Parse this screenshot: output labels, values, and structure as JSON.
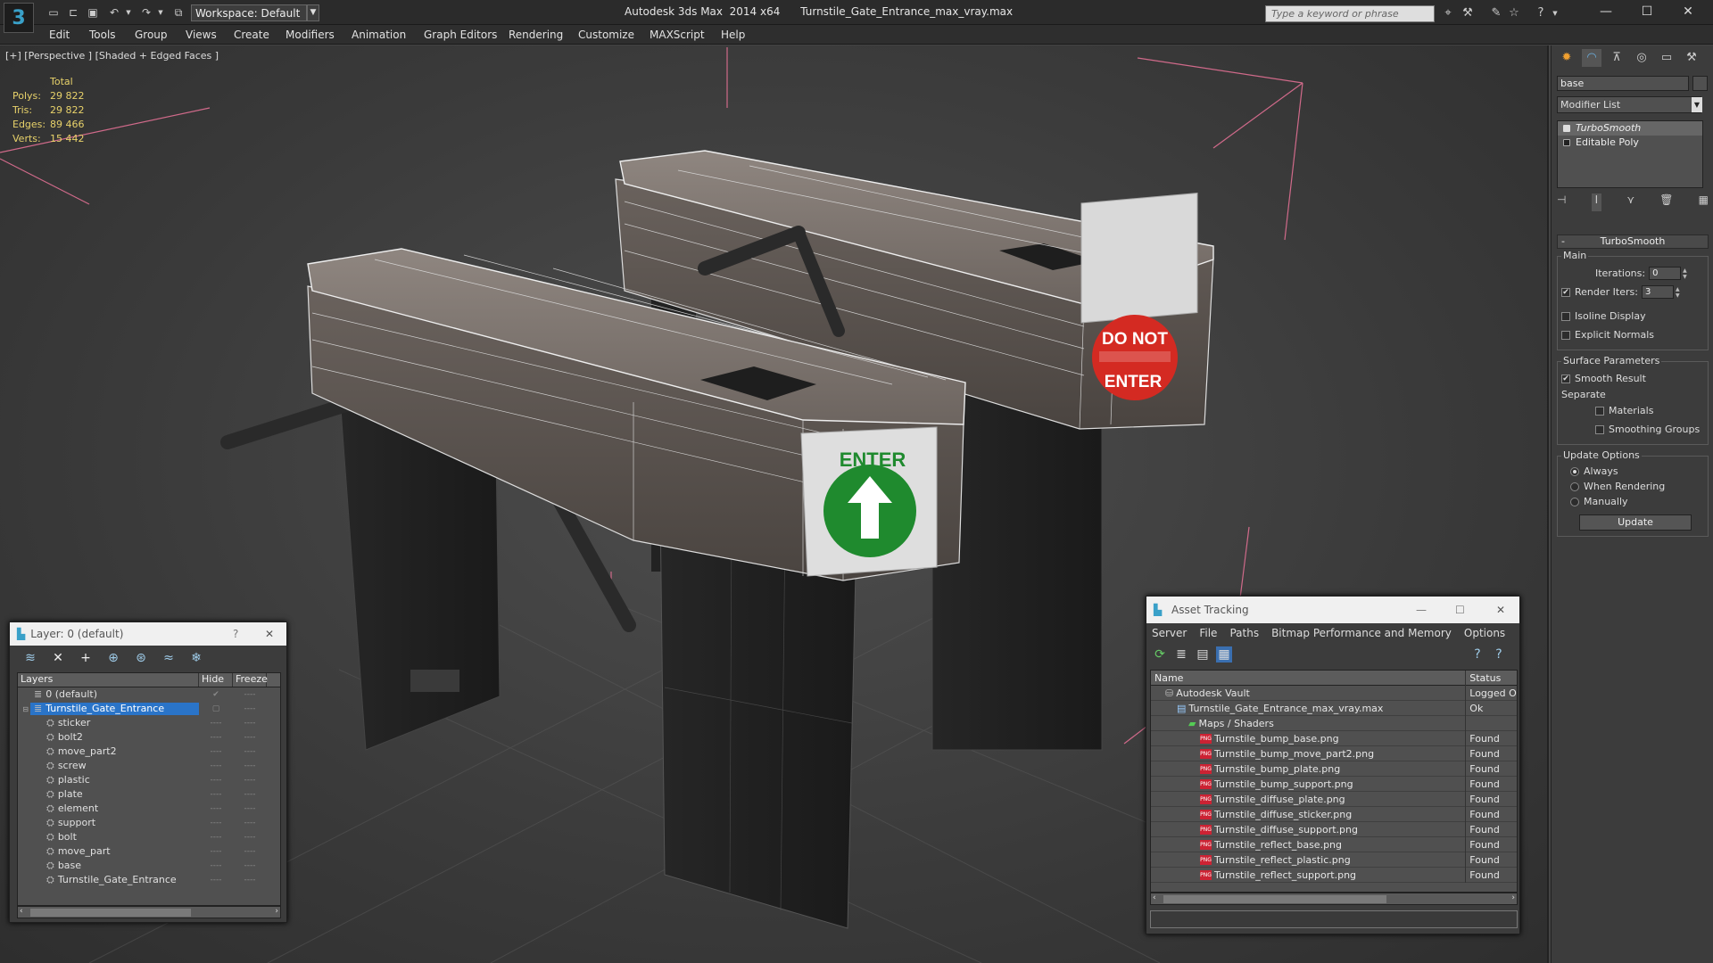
{
  "window": {
    "title": "Autodesk 3ds Max  2014 x64      Turnstile_Gate_Entrance_max_vray.max",
    "workspace": "Workspace: Default",
    "search_placeholder": "Type a keyword or phrase"
  },
  "menu": [
    "Edit",
    "Tools",
    "Group",
    "Views",
    "Create",
    "Modifiers",
    "Animation",
    "Graph Editors",
    "Rendering",
    "Customize",
    "MAXScript",
    "Help"
  ],
  "viewport": {
    "label": "[+] [Perspective ] [Shaded + Edged Faces ]",
    "stats": {
      "header": "Total",
      "rows": [
        {
          "label": "Polys:",
          "value": "29 822"
        },
        {
          "label": "Tris:",
          "value": "29 822"
        },
        {
          "label": "Edges:",
          "value": "89 466"
        },
        {
          "label": "Verts:",
          "value": "15 442"
        }
      ]
    },
    "sign_enter": "ENTER",
    "sign_do_not_line1": "DO NOT",
    "sign_do_not_line2": "ENTER"
  },
  "layer_panel": {
    "title": "Layer: 0 (default)",
    "help": "?",
    "close": "✕",
    "columns": {
      "layers": "Layers",
      "hide": "Hide",
      "freeze": "Freeze"
    },
    "rows": [
      {
        "name": "0 (default)",
        "hide": "✔",
        "freeze": "----",
        "selected": false
      },
      {
        "name": "Turnstile_Gate_Entrance",
        "hide": "▢",
        "freeze": "----",
        "selected": true
      },
      {
        "name": "sticker",
        "hide": "----",
        "freeze": "----"
      },
      {
        "name": "bolt2",
        "hide": "----",
        "freeze": "----"
      },
      {
        "name": "move_part2",
        "hide": "----",
        "freeze": "----"
      },
      {
        "name": "screw",
        "hide": "----",
        "freeze": "----"
      },
      {
        "name": "plastic",
        "hide": "----",
        "freeze": "----"
      },
      {
        "name": "plate",
        "hide": "----",
        "freeze": "----"
      },
      {
        "name": "element",
        "hide": "----",
        "freeze": "----"
      },
      {
        "name": "support",
        "hide": "----",
        "freeze": "----"
      },
      {
        "name": "bolt",
        "hide": "----",
        "freeze": "----"
      },
      {
        "name": "move_part",
        "hide": "----",
        "freeze": "----"
      },
      {
        "name": "base",
        "hide": "----",
        "freeze": "----"
      },
      {
        "name": "Turnstile_Gate_Entrance",
        "hide": "----",
        "freeze": "----"
      }
    ]
  },
  "asset_panel": {
    "title": "Asset Tracking",
    "menu": [
      "Server",
      "File",
      "Paths",
      "Bitmap Performance and Memory",
      "Options"
    ],
    "columns": {
      "name": "Name",
      "status": "Status"
    },
    "rows": [
      {
        "name": "Autodesk Vault",
        "status": "Logged O",
        "indent": 0
      },
      {
        "name": "Turnstile_Gate_Entrance_max_vray.max",
        "status": "Ok",
        "indent": 1
      },
      {
        "name": "Maps / Shaders",
        "status": "",
        "indent": 2
      },
      {
        "name": "Turnstile_bump_base.png",
        "status": "Found",
        "indent": 3
      },
      {
        "name": "Turnstile_bump_move_part2.png",
        "status": "Found",
        "indent": 3
      },
      {
        "name": "Turnstile_bump_plate.png",
        "status": "Found",
        "indent": 3
      },
      {
        "name": "Turnstile_bump_support.png",
        "status": "Found",
        "indent": 3
      },
      {
        "name": "Turnstile_diffuse_plate.png",
        "status": "Found",
        "indent": 3
      },
      {
        "name": "Turnstile_diffuse_sticker.png",
        "status": "Found",
        "indent": 3
      },
      {
        "name": "Turnstile_diffuse_support.png",
        "status": "Found",
        "indent": 3
      },
      {
        "name": "Turnstile_reflect_base.png",
        "status": "Found",
        "indent": 3
      },
      {
        "name": "Turnstile_reflect_plastic.png",
        "status": "Found",
        "indent": 3
      },
      {
        "name": "Turnstile_reflect_support.png",
        "status": "Found",
        "indent": 3
      }
    ]
  },
  "command_panel": {
    "object_name": "base",
    "modifier_list": "Modifier List",
    "stack": [
      {
        "name": "TurboSmooth",
        "active": true
      },
      {
        "name": "Editable Poly",
        "active": false
      }
    ],
    "rollout_title": "TurboSmooth",
    "main_group": "Main",
    "iterations_label": "Iterations:",
    "iterations_value": "0",
    "render_iters_label": "Render Iters:",
    "render_iters_value": "3",
    "isoline_label": "Isoline Display",
    "explicit_normals_label": "Explicit Normals",
    "surface_group": "Surface Parameters",
    "smooth_result_label": "Smooth Result",
    "separate_label": "Separate",
    "materials_label": "Materials",
    "smoothing_groups_label": "Smoothing Groups",
    "update_group": "Update Options",
    "always_label": "Always",
    "when_rendering_label": "When Rendering",
    "manually_label": "Manually",
    "update_button": "Update"
  },
  "colors": {
    "selection": "#2a74c8",
    "stats_text": "#e8d26a",
    "sign_green": "#1f8a2e",
    "sign_red": "#d42a22"
  }
}
